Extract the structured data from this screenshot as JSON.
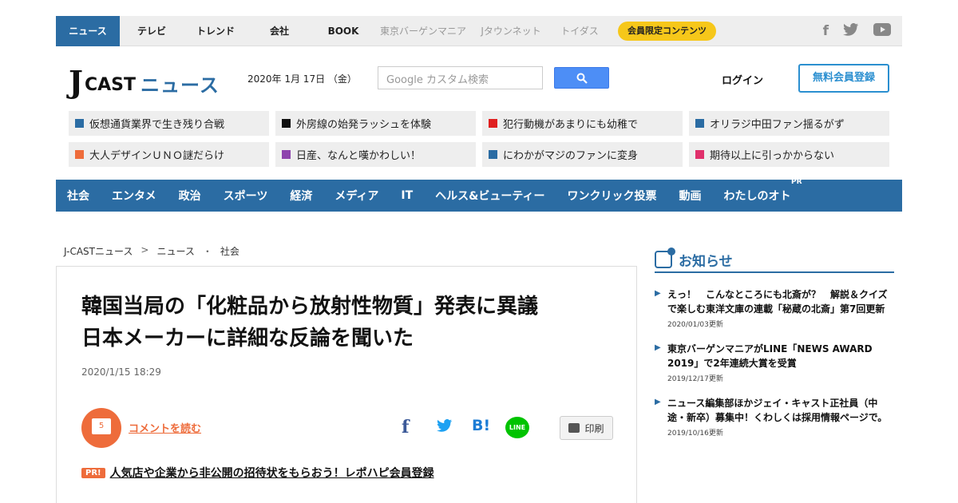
{
  "topnav": {
    "items": [
      {
        "label": "ニュース",
        "active": true
      },
      {
        "label": "テレビ"
      },
      {
        "label": "トレンド"
      },
      {
        "label": "会社"
      },
      {
        "label": "BOOK"
      },
      {
        "label": "東京バーゲンマニア",
        "muted": true
      },
      {
        "label": "Jタウンネット",
        "muted": true
      },
      {
        "label": "トイダス",
        "muted": true
      }
    ],
    "member_label": "会員限定コンテンツ",
    "social": {
      "facebook": "f",
      "twitter": "twitter-icon",
      "youtube": "youtube-icon"
    }
  },
  "header": {
    "logo_j": "J",
    "logo_cast": "CAST",
    "logo_news": "ニュース",
    "date": "2020年 1月 17日 （金）",
    "search_placeholder": "Google カスタム検索",
    "login": "ログイン",
    "register": "無料会員登録"
  },
  "tiles": [
    {
      "label": "仮想通貨業界で生き残り合戦",
      "color": "#2b6ca3"
    },
    {
      "label": "外房線の始発ラッシュを体験",
      "color": "#111111"
    },
    {
      "label": "犯行動機があまりにも幼稚で",
      "color": "#e02020"
    },
    {
      "label": "オリラジ中田ファン揺るがず",
      "color": "#2b6ca3"
    },
    {
      "label": "大人デザインＵＮＯ謎だらけ",
      "color": "#ee6c3b"
    },
    {
      "label": "日産、なんと嘆かわしい！",
      "color": "#8e44ad"
    },
    {
      "label": "にわかがマジのファンに変身",
      "color": "#2b6ca3"
    },
    {
      "label": "期待以上に引っかからない",
      "color": "#e0306b"
    }
  ],
  "catnav": {
    "items": [
      "社会",
      "エンタメ",
      "政治",
      "スポーツ",
      "経済",
      "メディア",
      "IT",
      "ヘルス&ビューティー",
      "ワンクリック投票",
      "動画",
      "わたしのオト"
    ],
    "pr_label": "PR"
  },
  "breadcrumb": {
    "home": "J-CASTニュース",
    "sep1": ">",
    "section": "ニュース",
    "sep2": "・",
    "category": "社会"
  },
  "article": {
    "title_line1": "韓国当局の「化粧品から放射性物質」発表に異議",
    "title_line2": "日本メーカーに詳細な反論を聞いた",
    "date": "2020/1/15 18:29",
    "comment_count": "5",
    "comment_link": "コメントを読む",
    "share": {
      "facebook": "f",
      "twitter": "twitter-icon",
      "hatena": "B!",
      "line": "LINE"
    },
    "print_label": "印刷",
    "pr_badge": "PR!",
    "pr_text": "人気店や企業から非公開の招待状をもらおう！レポハピ会員登録"
  },
  "sidebar": {
    "heading": "お知らせ",
    "notices": [
      {
        "text": "えっ！　こんなところにも北斎が？　解説＆クイズで楽しむ東洋文庫の連載「秘蔵の北斎」第7回更新",
        "updated": "2020/01/03更新"
      },
      {
        "text": "東京バーゲンマニアがLINE「NEWS AWARD 2019」で2年連続大賞を受賞",
        "updated": "2019/12/17更新"
      },
      {
        "text": "ニュース編集部ほかジェイ・キャスト正社員（中途・新卒）募集中！くわしくは採用情報ページで。",
        "updated": "2019/10/16更新"
      }
    ]
  },
  "colors": {
    "brand_blue": "#2b6ca3",
    "accent_orange": "#ee6c3b",
    "member_yellow": "#f6c71a"
  }
}
